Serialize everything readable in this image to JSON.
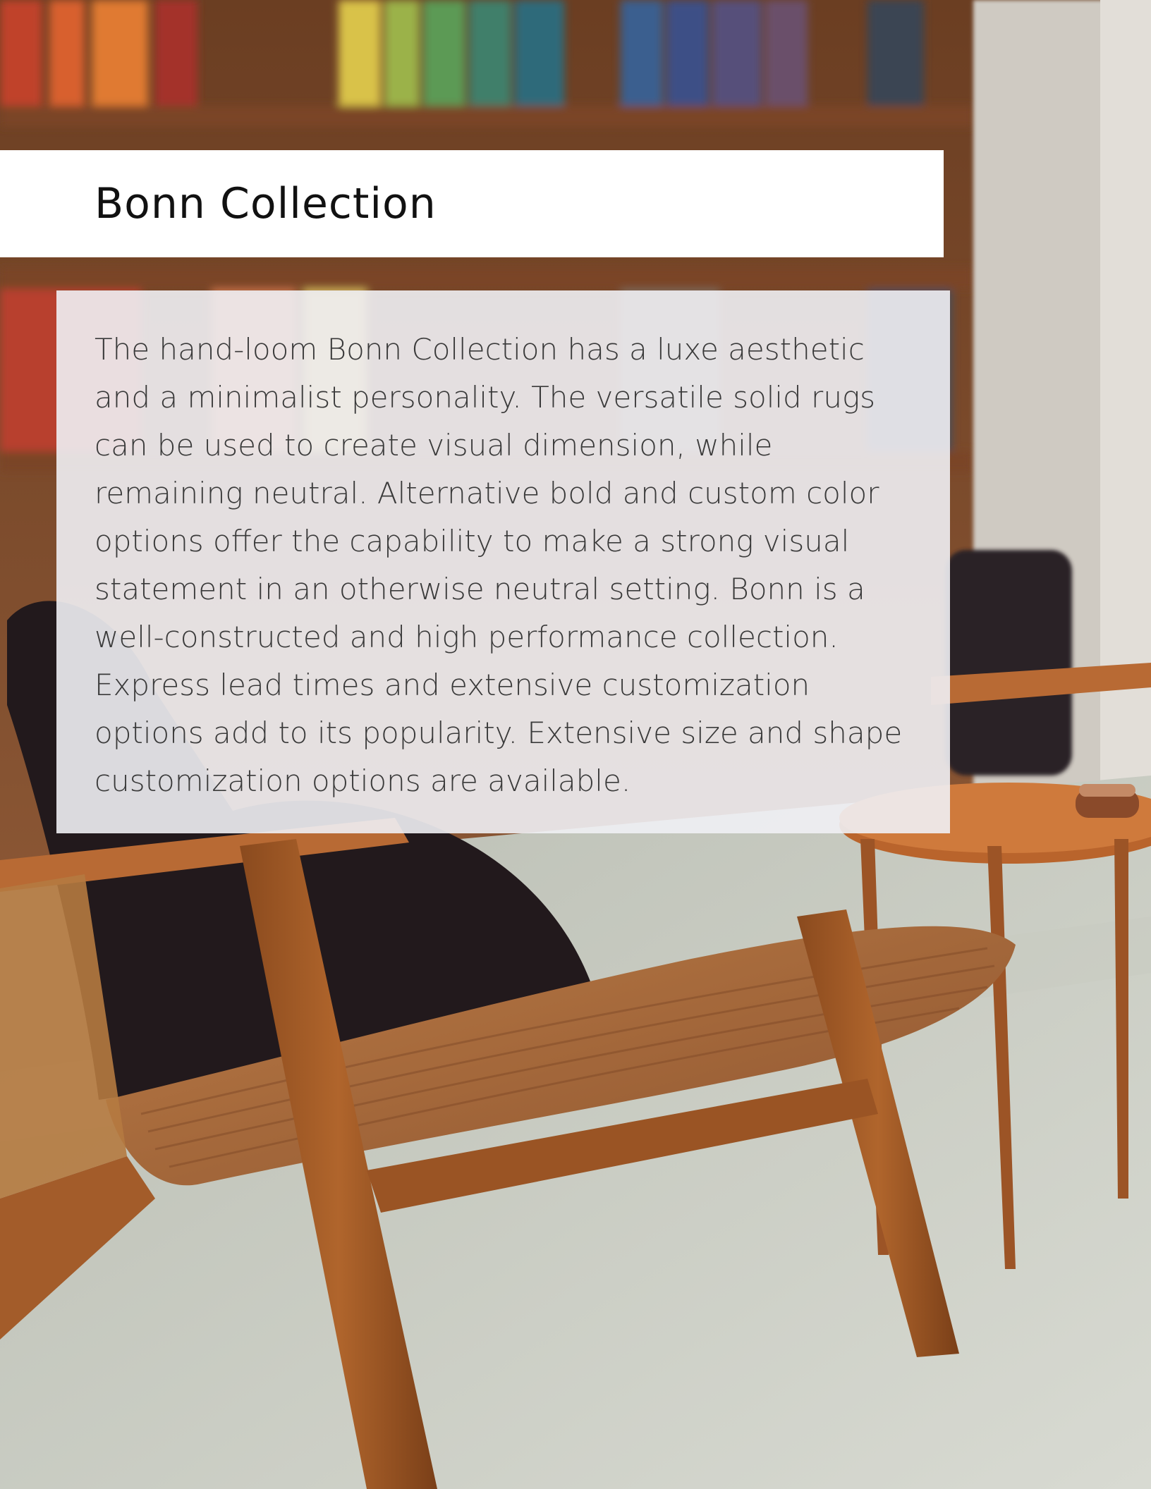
{
  "document": {
    "title": "Bonn Collection",
    "body": "The hand-loom Bonn Collection has a luxe aesthetic and a minimalist personality. The versatile solid rugs can be used to create visual dimension, while remaining neutral. Alternative bold and custom color options offer the capability to make a strong visual statement in an otherwise neutral setting. Bonn is a well-constructed and high performance collection. Express lead times and extensive customization options add to its popularity. Extensive size and shape customization options are available."
  },
  "colors": {
    "banner": "#ffffff",
    "panel": "#f0f0f4",
    "title_text": "#111111",
    "body_text": "#3a3a3a"
  }
}
